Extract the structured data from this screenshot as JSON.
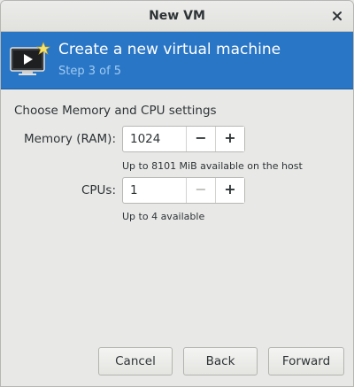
{
  "window": {
    "title": "New VM",
    "close_icon": "close-icon"
  },
  "banner": {
    "icon": "virtual-machine-icon",
    "title": "Create a new virtual machine",
    "step": "Step 3 of 5",
    "background_color": "#2a76c6"
  },
  "content": {
    "heading": "Choose Memory and CPU settings",
    "memory": {
      "label": "Memory (RAM):",
      "value": "1024",
      "decrement_label": "−",
      "increment_label": "+",
      "hint": "Up to 8101 MiB available on the host"
    },
    "cpus": {
      "label": "CPUs:",
      "value": "1",
      "decrement_label": "−",
      "increment_label": "+",
      "hint": "Up to 4 available"
    }
  },
  "footer": {
    "cancel_label": "Cancel",
    "back_label": "Back",
    "forward_label": "Forward"
  }
}
